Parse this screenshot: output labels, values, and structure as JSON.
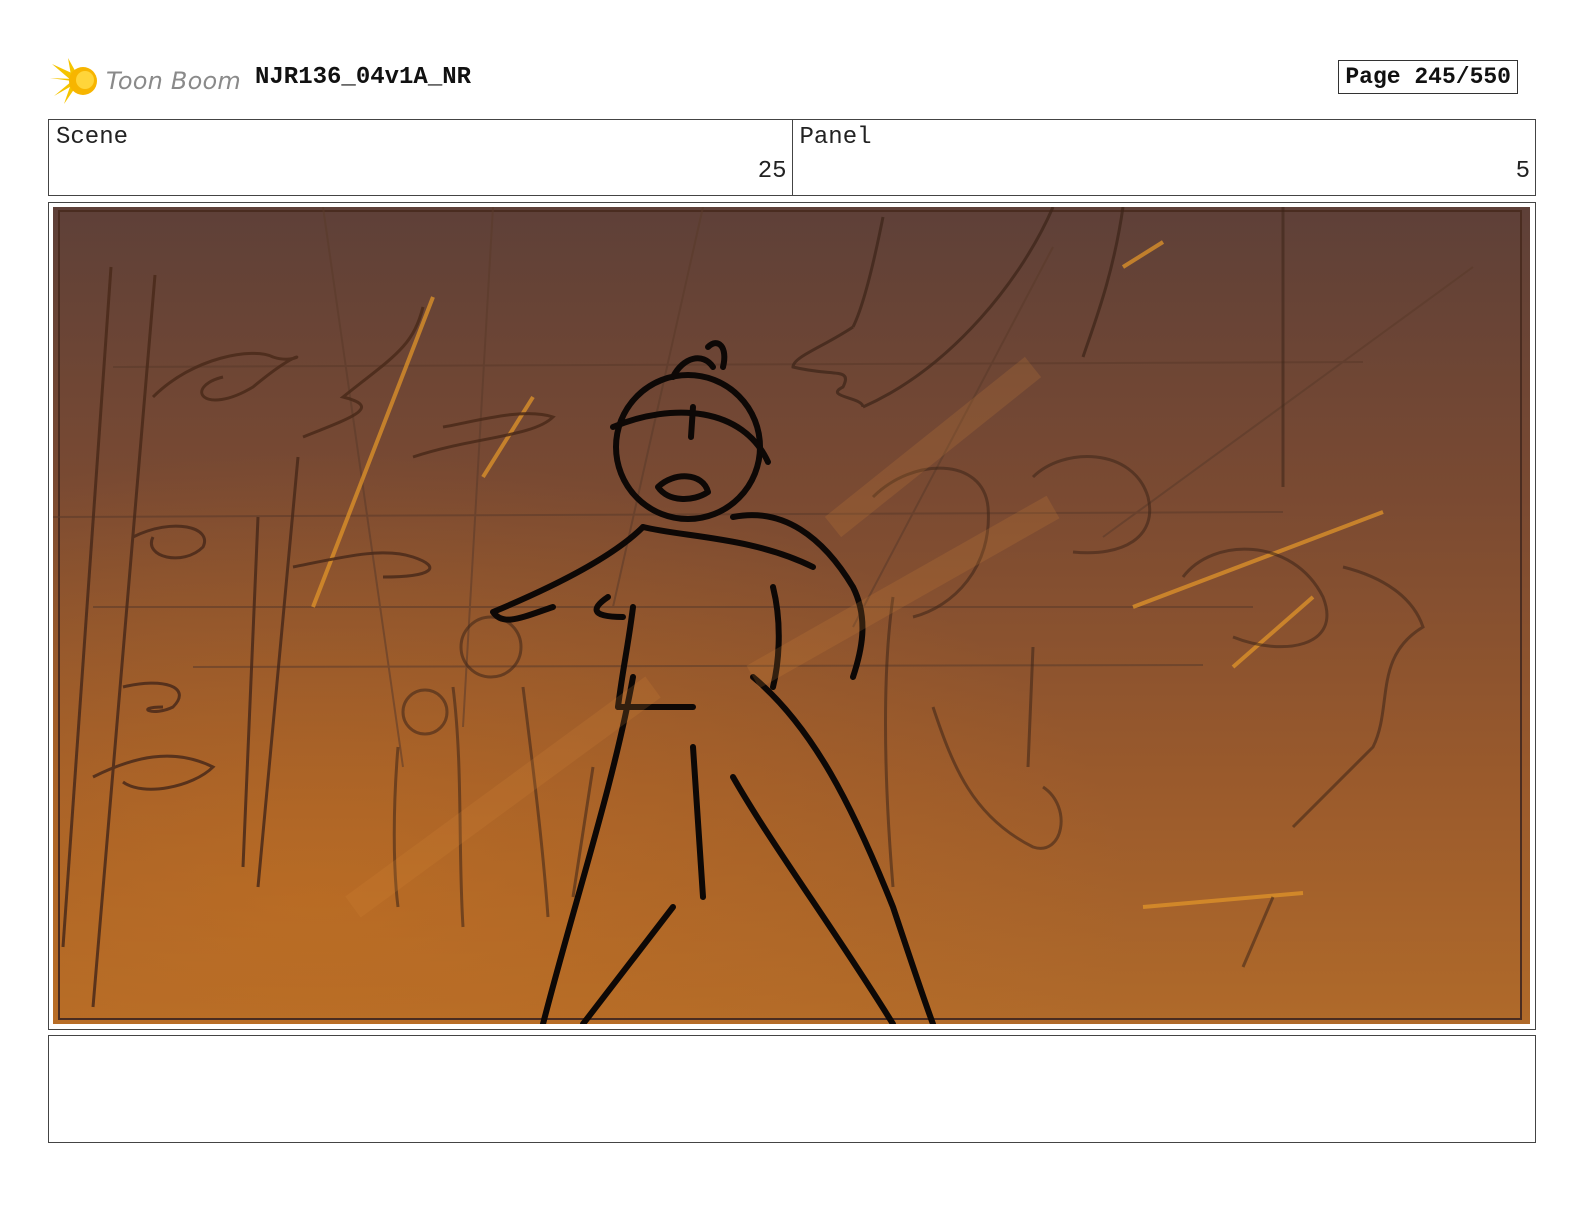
{
  "header": {
    "logo_text": "Toon Boom",
    "doc_title": "NJR136_04v1A_NR",
    "page_label": "Page 245/550"
  },
  "info": {
    "scene_label": "Scene",
    "scene_value": "25",
    "panel_label": "Panel",
    "panel_value": "5"
  },
  "notes": {
    "text": ""
  }
}
